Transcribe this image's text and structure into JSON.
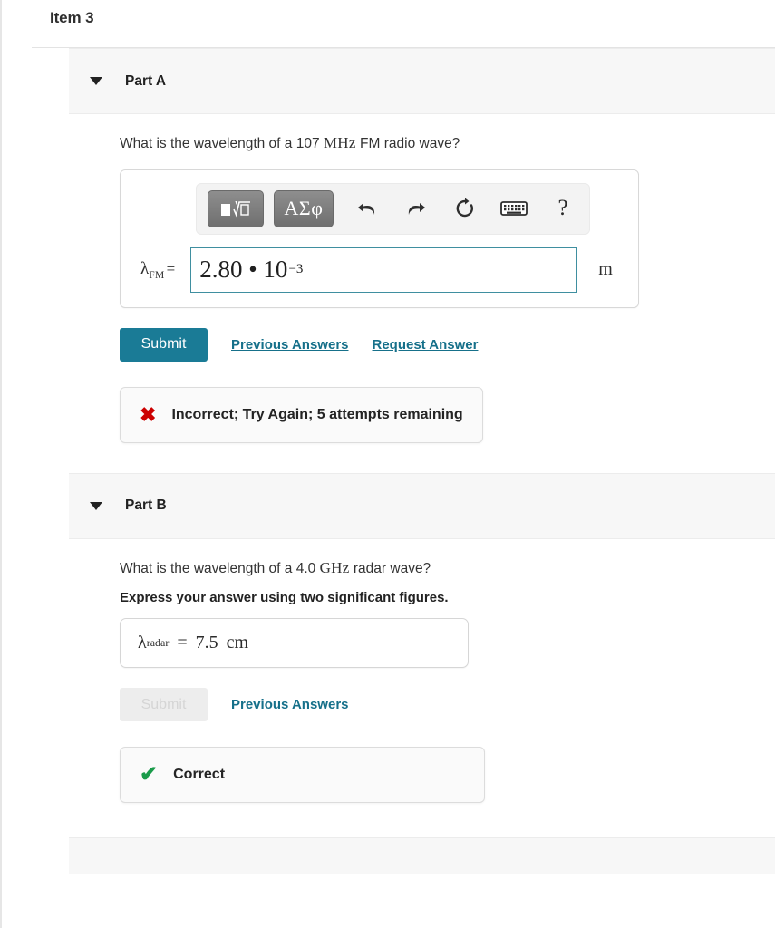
{
  "item": {
    "title": "Item 3"
  },
  "parts": [
    {
      "id": "part-a",
      "caret_icon": "caret-down-icon",
      "label": "Part A",
      "question_prefix": "What is the wavelength of a 107 ",
      "question_unit": "MHz",
      "question_suffix": " FM radio wave?",
      "instruction": "",
      "editor": {
        "toolbar": [
          {
            "name": "math-template-button",
            "label": "■√□",
            "kind": "template"
          },
          {
            "name": "greek-symbols-button",
            "label": "ΑΣφ",
            "kind": "greek"
          },
          {
            "name": "undo-icon",
            "label": "↶",
            "kind": "icon"
          },
          {
            "name": "redo-icon",
            "label": "↷",
            "kind": "icon"
          },
          {
            "name": "reset-icon",
            "label": "↺",
            "kind": "icon"
          },
          {
            "name": "keyboard-icon",
            "label": "⌨",
            "kind": "icon"
          },
          {
            "name": "help-icon",
            "label": "?",
            "kind": "help"
          }
        ],
        "variable": "λ",
        "subscript": "FM",
        "equals": "=",
        "value_mantissa": "2.80 • 10",
        "value_exponent": "−3",
        "unit": "m"
      },
      "submit_label": "Submit",
      "submit_disabled": false,
      "links": [
        "Previous Answers",
        "Request Answer"
      ],
      "feedback": {
        "status": "incorrect",
        "icon": "cross-icon",
        "glyph": "✖",
        "text": "Incorrect; Try Again; 5 attempts remaining"
      }
    },
    {
      "id": "part-b",
      "caret_icon": "caret-down-icon",
      "label": "Part B",
      "question_prefix": "What is the wavelength of a 4.0 ",
      "question_unit": "GHz",
      "question_suffix": " radar wave?",
      "instruction": "Express your answer using two significant figures.",
      "readonly_answer": {
        "variable": "λ",
        "subscript": "radar",
        "equals": "=",
        "value": "7.5",
        "unit": "cm"
      },
      "submit_label": "Submit",
      "submit_disabled": true,
      "links": [
        "Previous Answers"
      ],
      "feedback": {
        "status": "correct",
        "icon": "check-icon",
        "glyph": "✔",
        "text": "Correct"
      }
    }
  ],
  "colors": {
    "accent_teal": "#1a7b96",
    "link_teal": "#16708a",
    "incorrect_red": "#cc0000",
    "correct_green": "#1a9b4a",
    "header_grey": "#f7f7f7",
    "input_focus_border": "#3f8fa0"
  }
}
